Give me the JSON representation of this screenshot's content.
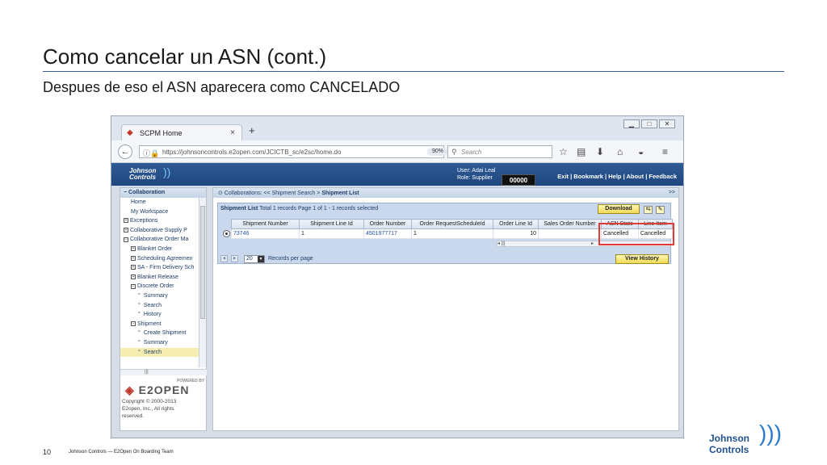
{
  "slide": {
    "title": "Como cancelar un ASN (cont.)",
    "subtitle": "Despues de eso el ASN aparecera como CANCELADO",
    "page_number": "10",
    "footer": "Johnson Controls  —  E2Open On Boarding Team",
    "logo_line1": "Johnson",
    "logo_line2": "Controls"
  },
  "browser": {
    "tab_title": "SCPM Home",
    "tab_close": "×",
    "new_tab": "+",
    "url": "https://johnsoncontrols.e2open.com/JCICTB_sc/e2sc/home.do",
    "zoom": "90%",
    "search_placeholder": "Search"
  },
  "app": {
    "logo_line1": "Johnson",
    "logo_line2": "Controls",
    "user_label": "User: Adai Leal",
    "role_label": "Role: Supplier",
    "badge": "00000",
    "top_links": "Exit | Bookmark | Help | About | Feedback"
  },
  "sidebar": {
    "header": "− Collaboration",
    "items": [
      {
        "label": "Home",
        "indent": 1,
        "box": ""
      },
      {
        "label": "My Workspace",
        "indent": 1,
        "box": ""
      },
      {
        "label": "Exceptions",
        "indent": 0,
        "box": "+"
      },
      {
        "label": "Collaborative Supply P",
        "indent": 0,
        "box": "+"
      },
      {
        "label": "Collaborative Order Ma",
        "indent": 0,
        "box": "−"
      },
      {
        "label": "Blanket Order",
        "indent": 1,
        "box": "+"
      },
      {
        "label": "Scheduling Agreemen",
        "indent": 1,
        "box": "+"
      },
      {
        "label": "SA - Firm Delivery Sch",
        "indent": 1,
        "box": "+"
      },
      {
        "label": "Blanket Release",
        "indent": 1,
        "box": "+"
      },
      {
        "label": "Discrete Order",
        "indent": 1,
        "box": "−"
      },
      {
        "label": "Summary",
        "indent": 2,
        "box": ""
      },
      {
        "label": "Search",
        "indent": 2,
        "box": ""
      },
      {
        "label": "History",
        "indent": 2,
        "box": ""
      },
      {
        "label": "Shipment",
        "indent": 1,
        "box": "−"
      },
      {
        "label": "Create Shipment",
        "indent": 2,
        "box": ""
      },
      {
        "label": "Summary",
        "indent": 2,
        "box": ""
      },
      {
        "label": "Search",
        "indent": 2,
        "box": "",
        "selected": true
      }
    ],
    "hscroll": "|||",
    "powered_by": "POWERED BY",
    "e2open_logo": "E2OPEN",
    "copyright_1": "Copyright © 2000-2013",
    "copyright_2": "E2open, Inc., All rights",
    "copyright_3": "reserved."
  },
  "main": {
    "breadcrumb_prefix": "Collaborations: <<",
    "breadcrumb_link": "Shipment Search",
    "breadcrumb_sep": ">",
    "breadcrumb_current": "Shipment List",
    "breadcrumb_more": ">>",
    "list_title": "Shipment List",
    "list_summary": "Total 1 records Page 1 of 1 - 1 records selected",
    "download_label": "Download",
    "columns": [
      "Shipment Number",
      "Shipment Line Id",
      "Order Number",
      "Order RequestScheduleId",
      "Order Line Id",
      "Sales Order Number",
      "ASN State",
      "Line Item"
    ],
    "row": {
      "shipment_number": "73746",
      "shipment_line_id": "1",
      "order_number": "4501977717",
      "request_schedule_id": "1",
      "order_line_id": "10",
      "sales_order_number": "",
      "asn_state": "Cancelled",
      "line_item": "Cancelled"
    },
    "page_size": "20",
    "records_per_page": "Records per page",
    "view_history_label": "View History"
  }
}
